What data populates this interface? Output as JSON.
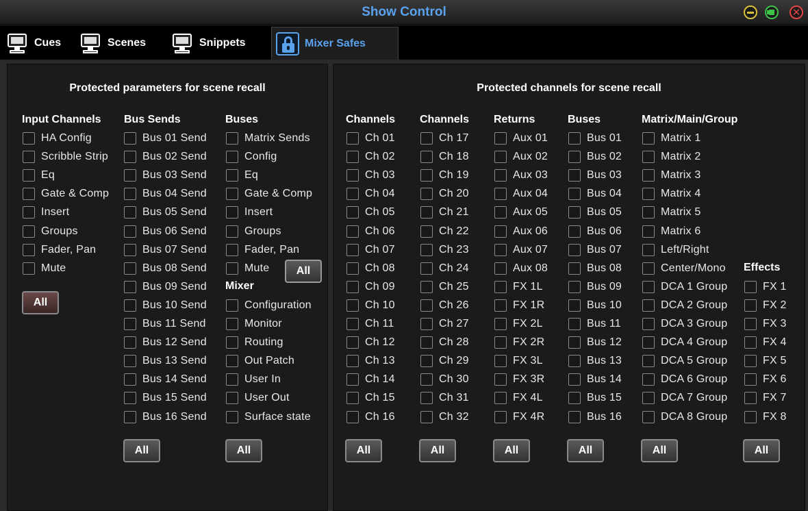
{
  "window": {
    "title": "Show Control"
  },
  "tabs": [
    {
      "label": "Cues",
      "icon": "monitor-icon"
    },
    {
      "label": "Scenes",
      "icon": "monitor-icon"
    },
    {
      "label": "Snippets",
      "icon": "monitor-icon"
    },
    {
      "label": "Mixer Safes",
      "icon": "lock-icon",
      "active": true
    }
  ],
  "left_panel": {
    "title": "Protected parameters for scene recall",
    "input_channels": {
      "heading": "Input Channels",
      "items": [
        "HA Config",
        "Scribble Strip",
        "Eq",
        "Gate & Comp",
        "Insert",
        "Groups",
        "Fader, Pan",
        "Mute"
      ],
      "all": "All"
    },
    "bus_sends": {
      "heading": "Bus Sends",
      "items": [
        "Bus 01 Send",
        "Bus 02 Send",
        "Bus 03 Send",
        "Bus 04 Send",
        "Bus 05 Send",
        "Bus 06 Send",
        "Bus 07 Send",
        "Bus 08 Send",
        "Bus 09 Send",
        "Bus 10 Send",
        "Bus 11 Send",
        "Bus 12 Send",
        "Bus 13 Send",
        "Bus 14 Send",
        "Bus 15 Send",
        "Bus 16 Send"
      ],
      "all": "All"
    },
    "buses": {
      "heading": "Buses",
      "items": [
        "Matrix Sends",
        "Config",
        "Eq",
        "Gate & Comp",
        "Insert",
        "Groups",
        "Fader, Pan",
        "Mute"
      ],
      "all": "All"
    },
    "mixer": {
      "heading": "Mixer",
      "items": [
        "Configuration",
        "Monitor",
        "Routing",
        "Out Patch",
        "User In",
        "User Out",
        "Surface state"
      ],
      "all": "All"
    }
  },
  "right_panel": {
    "title": "Protected channels for scene recall",
    "channels_a": {
      "heading": "Channels",
      "items": [
        "Ch 01",
        "Ch 02",
        "Ch 03",
        "Ch 04",
        "Ch 05",
        "Ch 06",
        "Ch 07",
        "Ch 08",
        "Ch 09",
        "Ch 10",
        "Ch 11",
        "Ch 12",
        "Ch 13",
        "Ch 14",
        "Ch 15",
        "Ch 16"
      ],
      "all": "All"
    },
    "channels_b": {
      "heading": "Channels",
      "items": [
        "Ch 17",
        "Ch 18",
        "Ch 19",
        "Ch 20",
        "Ch 21",
        "Ch 22",
        "Ch 23",
        "Ch 24",
        "Ch 25",
        "Ch 26",
        "Ch 27",
        "Ch 28",
        "Ch 29",
        "Ch 30",
        "Ch 31",
        "Ch 32"
      ],
      "all": "All"
    },
    "returns": {
      "heading": "Returns",
      "items": [
        "Aux 01",
        "Aux 02",
        "Aux 03",
        "Aux 04",
        "Aux 05",
        "Aux 06",
        "Aux 07",
        "Aux 08",
        "FX 1L",
        "FX 1R",
        "FX 2L",
        "FX 2R",
        "FX 3L",
        "FX 3R",
        "FX 4L",
        "FX 4R"
      ],
      "all": "All"
    },
    "buses": {
      "heading": "Buses",
      "items": [
        "Bus 01",
        "Bus 02",
        "Bus 03",
        "Bus 04",
        "Bus 05",
        "Bus 06",
        "Bus 07",
        "Bus 08",
        "Bus 09",
        "Bus 10",
        "Bus 11",
        "Bus 12",
        "Bus 13",
        "Bus 14",
        "Bus 15",
        "Bus 16"
      ],
      "all": "All"
    },
    "matrix": {
      "heading": "Matrix/Main/Group",
      "items": [
        "Matrix 1",
        "Matrix 2",
        "Matrix 3",
        "Matrix 4",
        "Matrix 5",
        "Matrix 6",
        "Left/Right",
        "Center/Mono",
        "DCA 1 Group",
        "DCA 2 Group",
        "DCA 3 Group",
        "DCA 4 Group",
        "DCA 5 Group",
        "DCA 6 Group",
        "DCA 7 Group",
        "DCA 8 Group"
      ],
      "all": "All"
    },
    "effects": {
      "heading": "Effects",
      "items": [
        "FX 1",
        "FX 2",
        "FX 3",
        "FX 4",
        "FX 5",
        "FX 6",
        "FX 7",
        "FX 8"
      ],
      "all": "All"
    }
  }
}
